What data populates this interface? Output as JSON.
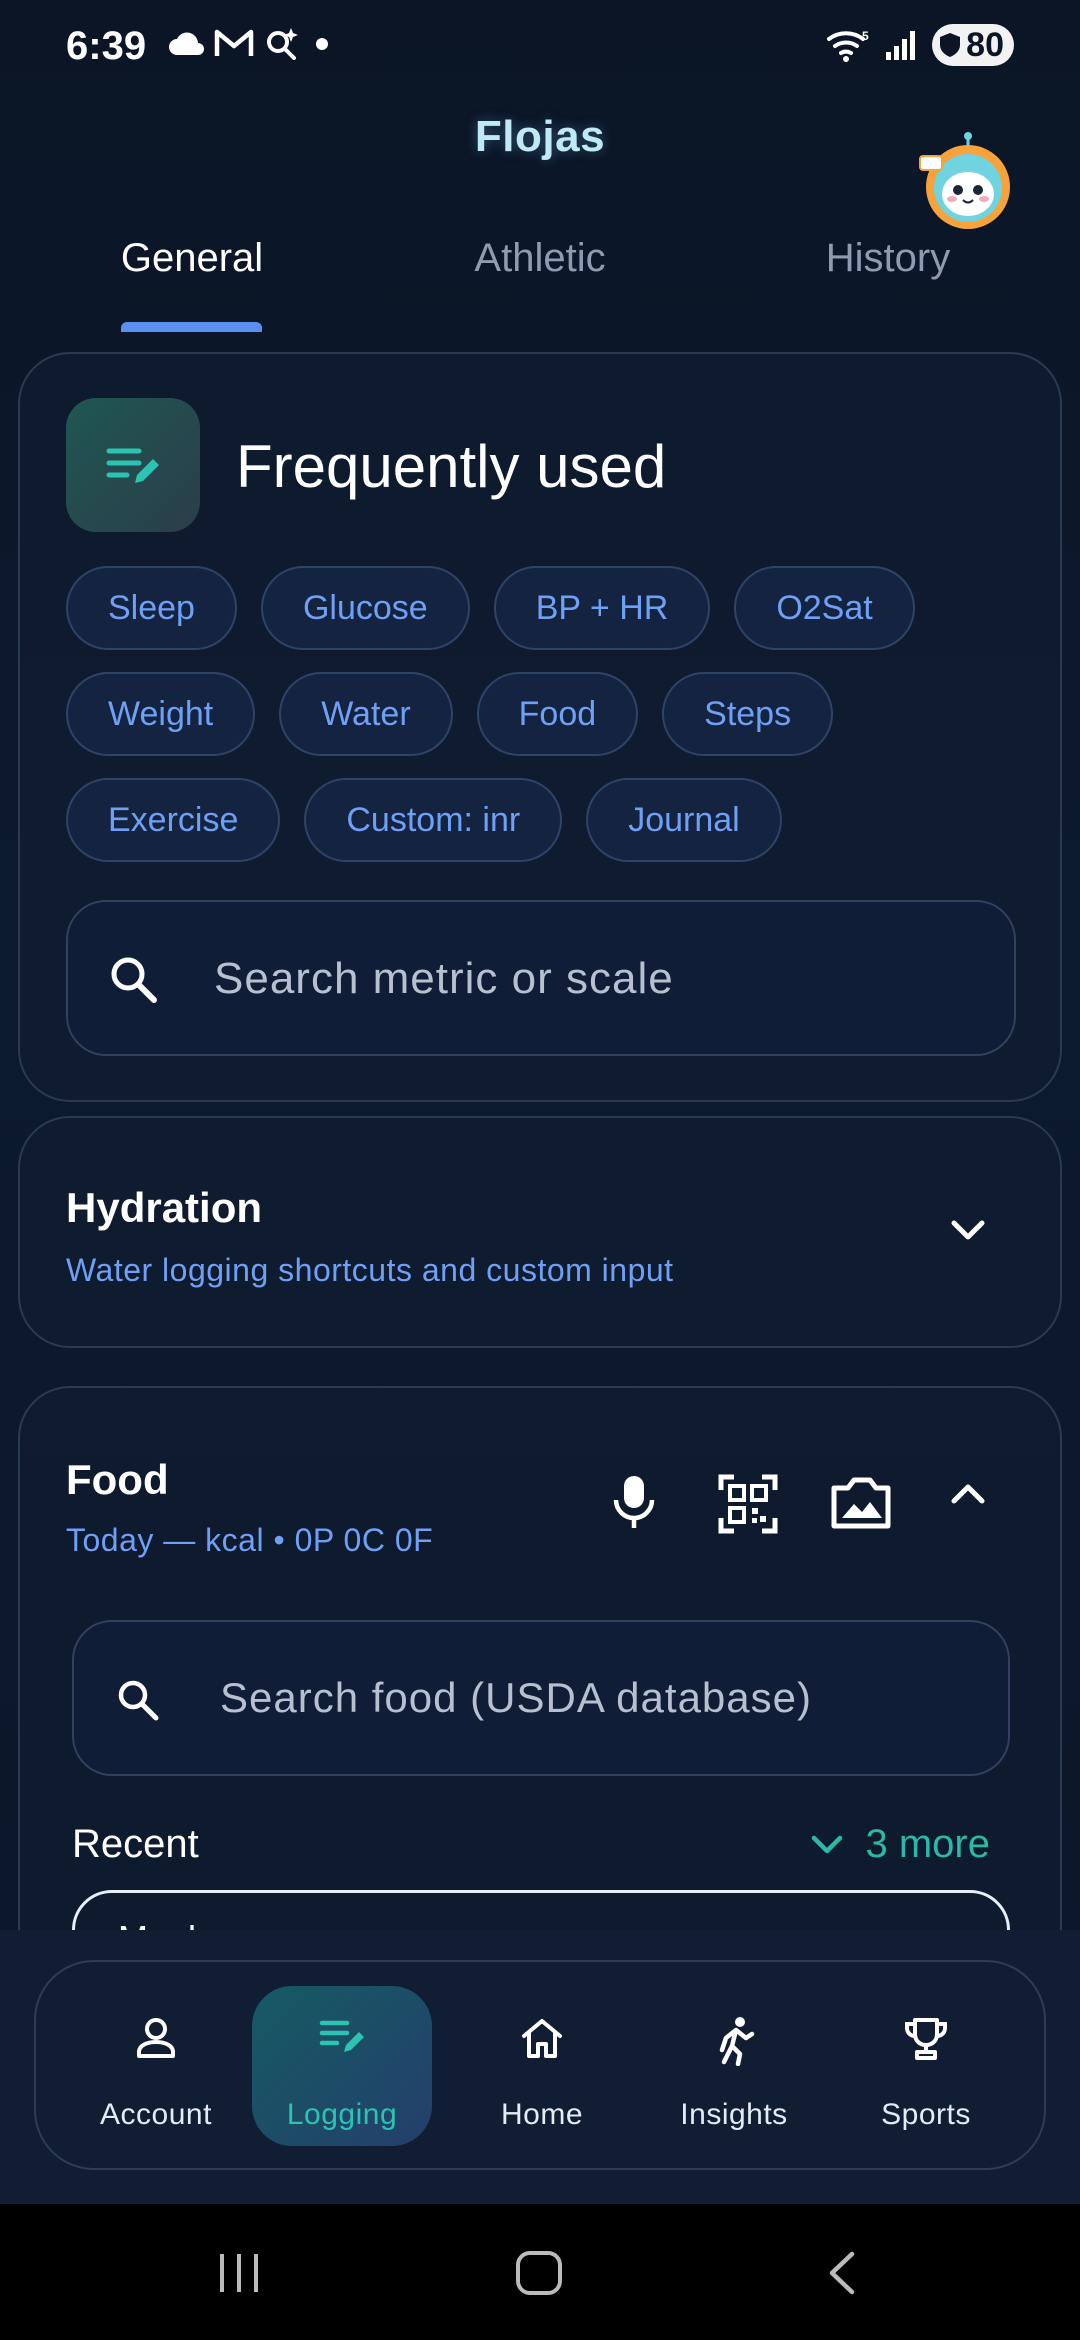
{
  "status_bar": {
    "time": "6:39",
    "battery": "80"
  },
  "header": {
    "app_title": "Flojas"
  },
  "tabs": [
    {
      "label": "General",
      "active": true
    },
    {
      "label": "Athletic",
      "active": false
    },
    {
      "label": "History",
      "active": false
    }
  ],
  "frequently_used": {
    "title": "Frequently used",
    "chips_row1": [
      "Sleep",
      "Glucose",
      "BP + HR",
      "O2Sat"
    ],
    "chips_row2": [
      "Weight",
      "Water",
      "Food",
      "Steps"
    ],
    "chips_row3": [
      "Exercise",
      "Custom: inr",
      "Journal"
    ],
    "search_placeholder": "Search metric or scale"
  },
  "hydration": {
    "title": "Hydration",
    "subtitle": "Water logging shortcuts and custom input"
  },
  "food": {
    "title": "Food",
    "subtitle": "Today — kcal • 0P 0C 0F",
    "search_placeholder": "Search food (USDA database)",
    "recent_label": "Recent",
    "more_label": "3 more",
    "meal_label": "Meal"
  },
  "bottom_nav": [
    {
      "label": "Account",
      "icon": "person-icon",
      "active": false
    },
    {
      "label": "Logging",
      "icon": "edit-list-icon",
      "active": true
    },
    {
      "label": "Home",
      "icon": "home-icon",
      "active": false
    },
    {
      "label": "Insights",
      "icon": "runner-icon",
      "active": false
    },
    {
      "label": "Sports",
      "icon": "trophy-icon",
      "active": false
    }
  ],
  "colors": {
    "background": "#0b1526",
    "accent_blue": "#6fa0f5",
    "accent_teal": "#2bb8a6",
    "title_glow": "#bfe9f3"
  }
}
